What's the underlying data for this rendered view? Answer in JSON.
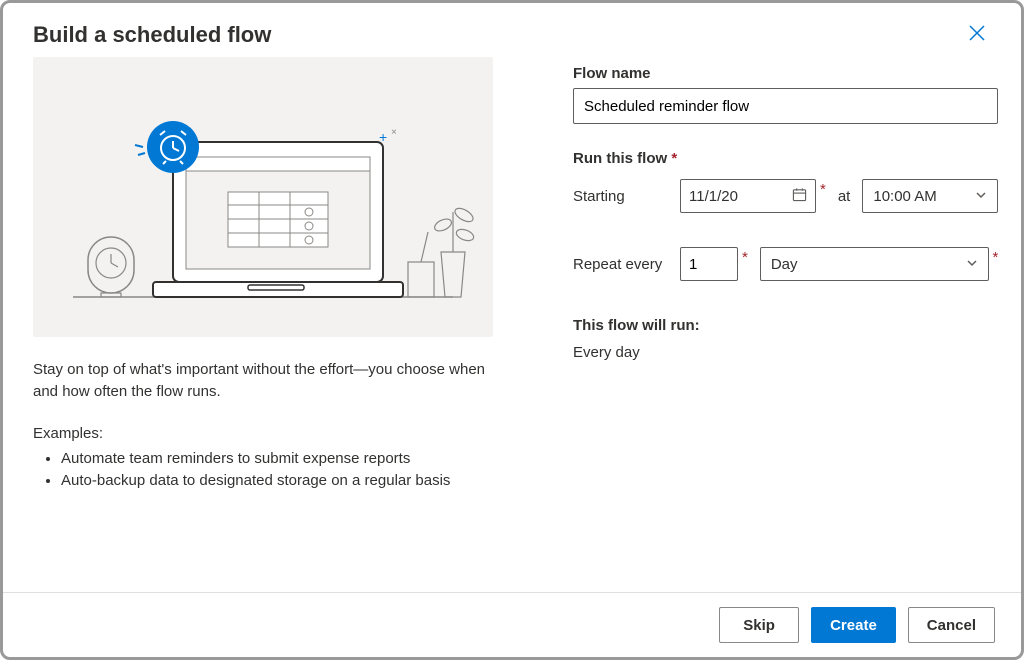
{
  "dialog": {
    "title": "Build a scheduled flow",
    "description": "Stay on top of what's important without the effort—you choose when and how often the flow runs.",
    "examples_label": "Examples:",
    "examples": [
      "Automate team reminders to submit expense reports",
      "Auto-backup data to designated storage on a regular basis"
    ]
  },
  "form": {
    "flow_name_label": "Flow name",
    "flow_name_value": "Scheduled reminder flow",
    "run_label": "Run this flow",
    "starting_label": "Starting",
    "starting_date": "11/1/20",
    "at_label": "at",
    "starting_time": "10:00 AM",
    "repeat_label": "Repeat every",
    "repeat_count": "1",
    "repeat_unit": "Day",
    "summary_label": "This flow will run:",
    "summary_text": "Every day"
  },
  "buttons": {
    "skip": "Skip",
    "create": "Create",
    "cancel": "Cancel"
  }
}
